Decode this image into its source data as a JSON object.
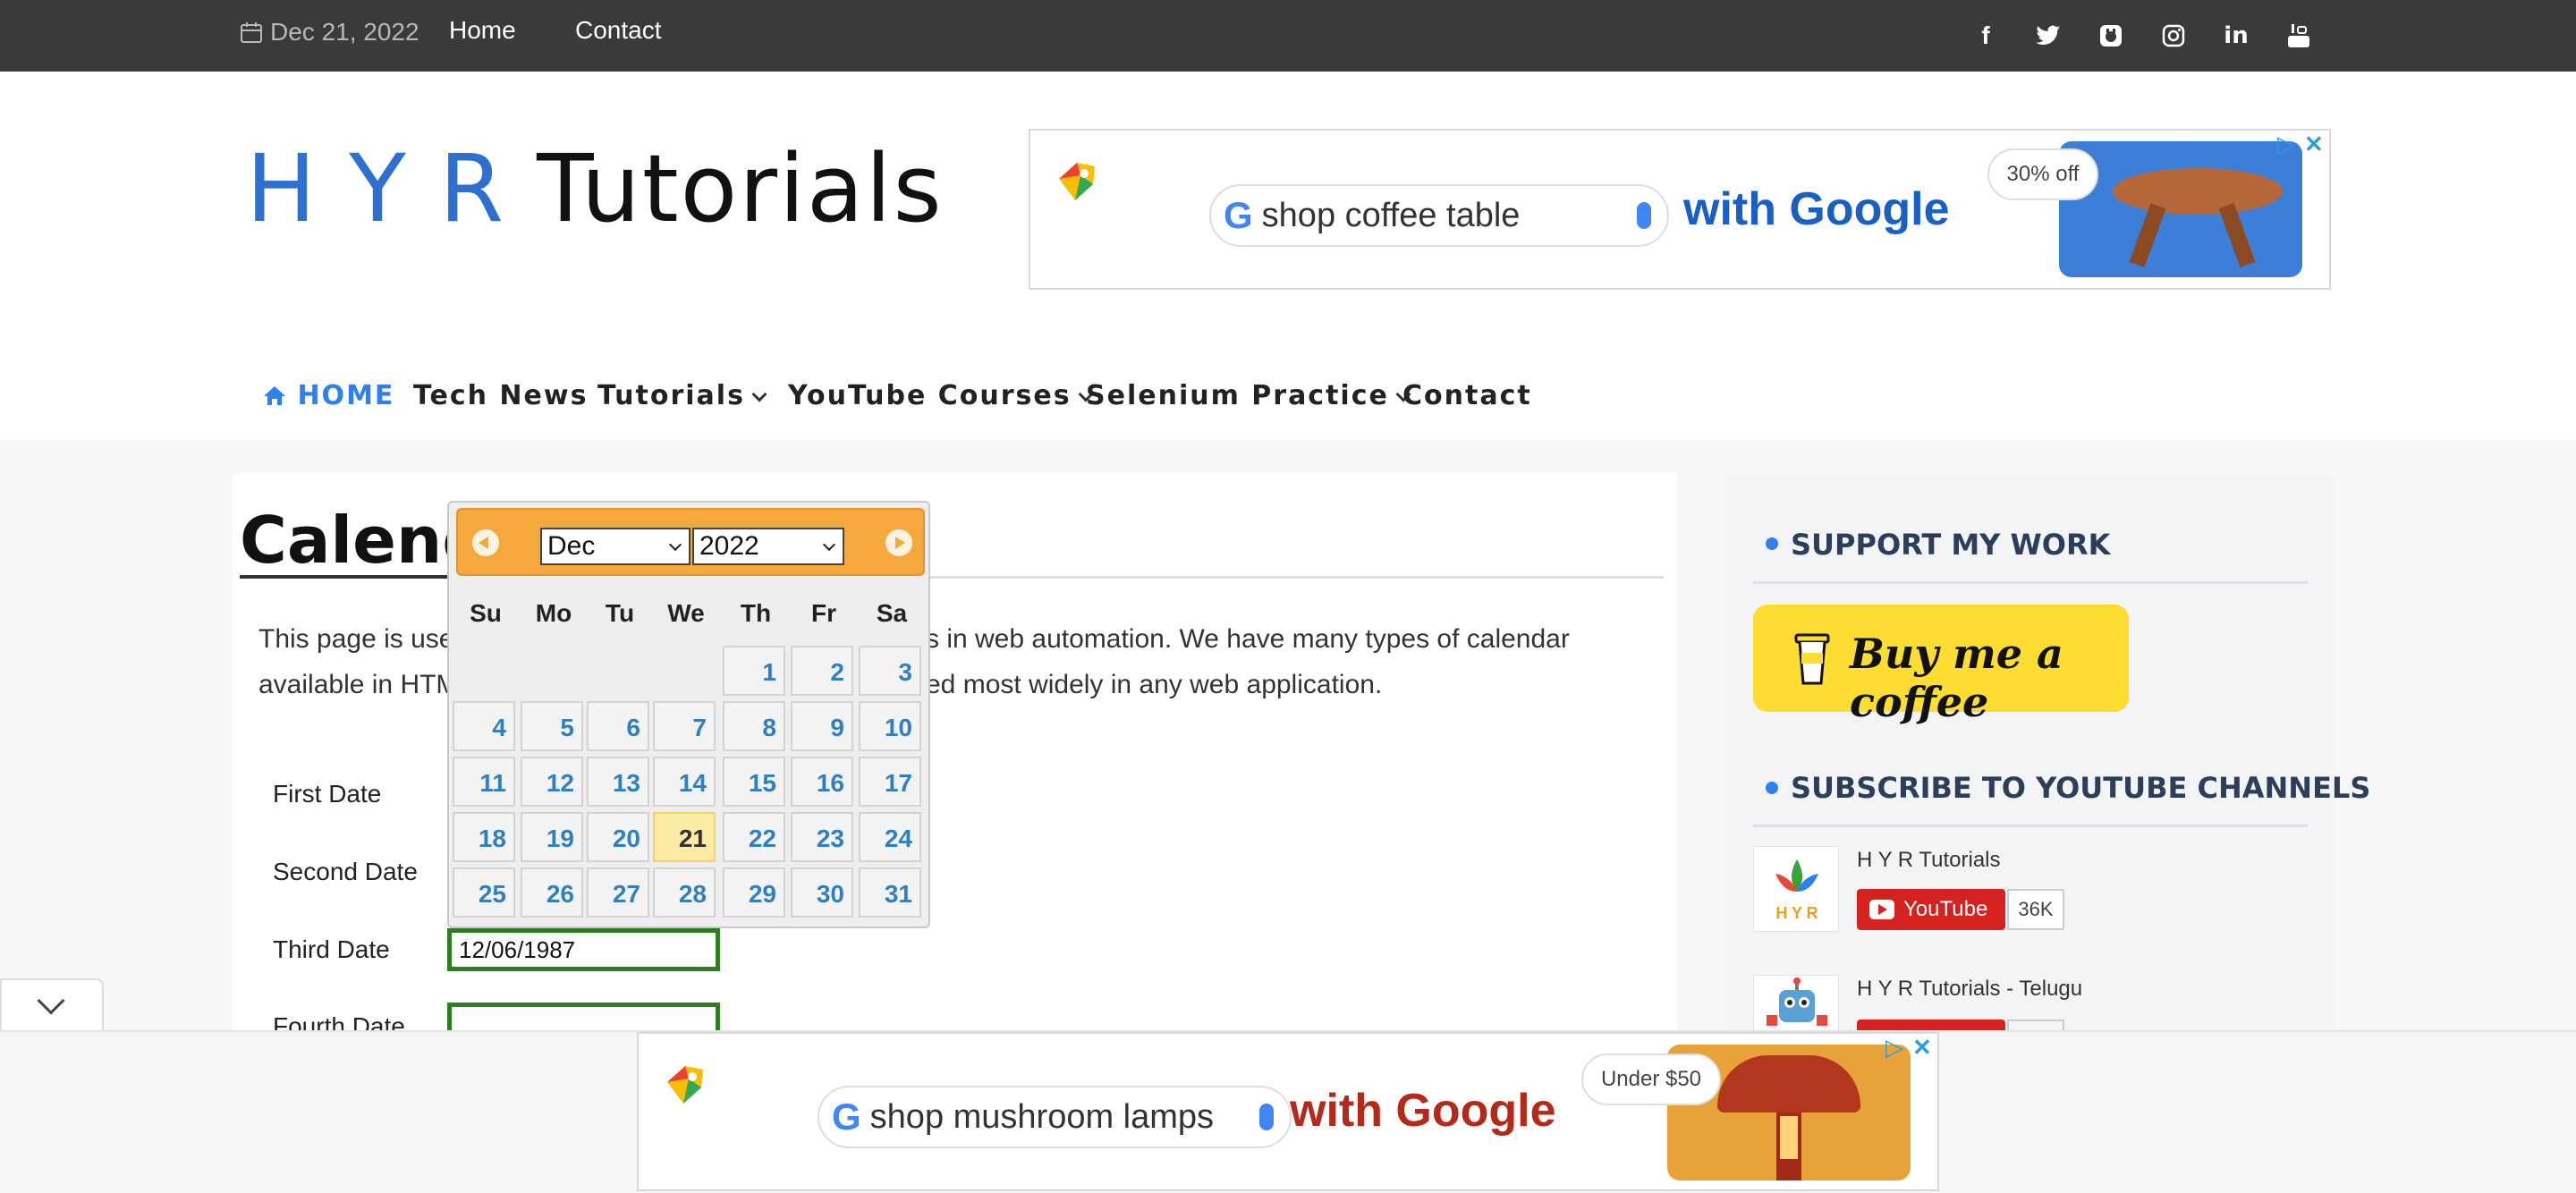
{
  "topbar": {
    "date": "Dec 21, 2022",
    "nav": [
      "Home",
      "Contact"
    ],
    "social_icons": [
      "facebook-icon",
      "twitter-icon",
      "github-icon",
      "instagram-icon",
      "linkedin-icon",
      "youtube-icon"
    ]
  },
  "logo": {
    "part1": "H Y R",
    "part2": "Tutorials"
  },
  "ad_top": {
    "query": "shop coffee table",
    "with": "with Google",
    "badge": "30% off"
  },
  "mainnav": [
    {
      "label": "HOME"
    },
    {
      "label": "Tech News"
    },
    {
      "label": "Tutorials"
    },
    {
      "label": "YouTube Courses"
    },
    {
      "label": "Selenium Practice"
    },
    {
      "label": "Contact"
    }
  ],
  "content": {
    "title": "Calendar",
    "para_line1_a": "This page is used",
    "para_line1_b": "s in web automation. We have many types of calendar",
    "para_line2_a": "available in HTM",
    "para_line2_b": "ed most widely in any web application.",
    "labels": [
      "First Date",
      "Second Date",
      "Third Date",
      "Fourth Date"
    ],
    "third_date_value": "12/06/1987"
  },
  "datepicker": {
    "month": "Dec",
    "year": "2022",
    "weekdays": [
      "Su",
      "Mo",
      "Tu",
      "We",
      "Th",
      "Fr",
      "Sa"
    ],
    "days": [
      "1",
      "2",
      "3",
      "4",
      "5",
      "6",
      "7",
      "8",
      "9",
      "10",
      "11",
      "12",
      "13",
      "14",
      "15",
      "16",
      "17",
      "18",
      "19",
      "20",
      "21",
      "22",
      "23",
      "24",
      "25",
      "26",
      "27",
      "28",
      "29",
      "30",
      "31"
    ],
    "today": "21"
  },
  "sidebar": {
    "support_heading": "SUPPORT MY WORK",
    "bmc_label": "Buy me a coffee",
    "subscribe_heading": "SUBSCRIBE TO YOUTUBE CHANNELS",
    "channels": [
      {
        "name": "H Y R Tutorials",
        "button": "YouTube",
        "count": "36K"
      },
      {
        "name": "H Y R Tutorials - Telugu"
      }
    ]
  },
  "ad_bottom": {
    "query": "shop mushroom lamps",
    "with": "with Google",
    "badge": "Under $50"
  },
  "colors": {
    "accent": "#2f80ed",
    "field_border": "#2e7d23",
    "dp_header": "#f5a83c"
  }
}
